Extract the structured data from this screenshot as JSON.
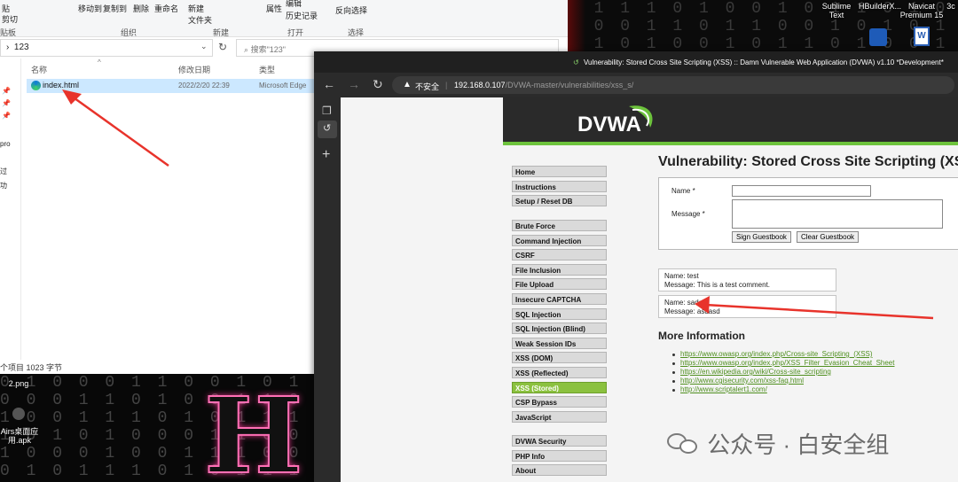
{
  "desktop": {
    "icons": [
      {
        "label_1": "Sublime",
        "label_2": "Text"
      },
      {
        "label_1": "HBuilderX...",
        "label_2": ""
      },
      {
        "label_1": "Navicat",
        "label_2": "Premium 15"
      },
      {
        "label_1": "3c",
        "label_2": ""
      }
    ],
    "left_icons": [
      {
        "label": "2.png"
      },
      {
        "label_1": "Airs桌面应",
        "label_2": "用.apk"
      }
    ],
    "word_doc_label": "Word"
  },
  "explorer": {
    "ribbon": {
      "paste": "贴",
      "cut": "剪切",
      "board_label": "贴板",
      "move_to": "移动到",
      "copy_to": "复制到",
      "delete": "删除",
      "rename": "重命名",
      "group_organize": "组织",
      "new_folder_1": "新建",
      "new_folder_2": "文件夹",
      "group_new": "新建",
      "properties": "属性",
      "edit": "编辑",
      "history": "历史记录",
      "group_open": "打开",
      "invert_select": "反向选择",
      "group_select": "选择"
    },
    "address": "123",
    "search_placeholder": "搜索\"123\"",
    "columns": {
      "name": "名称",
      "date": "修改日期",
      "type": "类型"
    },
    "file": {
      "name": "index.html",
      "date": "2022/2/20 22:39",
      "type": "Microsoft Edge"
    },
    "nav_labels": [
      "pro",
      "过",
      "功"
    ],
    "status": "个项目  1023 字节"
  },
  "browser": {
    "title": "Vulnerability: Stored Cross Site Scripting (XSS) :: Damn Vulnerable Web Application (DVWA) v1.10 *Development*",
    "security_label": "不安全",
    "url_host": "192.168.0.107",
    "url_path": "/DVWA-master/vulnerabilities/xss_s/"
  },
  "dvwa": {
    "logo_text": "DVWA",
    "menu": {
      "group1": [
        "Home",
        "Instructions",
        "Setup / Reset DB"
      ],
      "group2": [
        "Brute Force",
        "Command Injection",
        "CSRF",
        "File Inclusion",
        "File Upload",
        "Insecure CAPTCHA",
        "SQL Injection",
        "SQL Injection (Blind)",
        "Weak Session IDs",
        "XSS (DOM)",
        "XSS (Reflected)",
        "XSS (Stored)",
        "CSP Bypass",
        "JavaScript"
      ],
      "group3": [
        "DVWA Security",
        "PHP Info",
        "About"
      ],
      "active": "XSS (Stored)"
    },
    "page_title": "Vulnerability: Stored Cross Site Scripting (XSS",
    "form": {
      "name_label": "Name *",
      "message_label": "Message *",
      "sign_button": "Sign Guestbook",
      "clear_button": "Clear Guestbook"
    },
    "entries": [
      {
        "name": "Name: test",
        "message": "Message: This is a test comment."
      },
      {
        "name": "Name: sada",
        "message": "Message: asdasd"
      }
    ],
    "more_info_title": "More Information",
    "links": [
      "https://www.owasp.org/index.php/Cross-site_Scripting_(XSS)",
      "https://www.owasp.org/index.php/XSS_Filter_Evasion_Cheat_Sheet",
      "https://en.wikipedia.org/wiki/Cross-site_scripting",
      "http://www.cgisecurity.com/xss-faq.html",
      "http://www.scriptalert1.com/"
    ]
  },
  "watermark": "公众号 · 白安全组",
  "colors": {
    "dvwa_green": "#6dc33c",
    "link_green": "#4f8f1f",
    "arrow_red": "#e8332b",
    "selection_blue": "#cce8ff"
  }
}
